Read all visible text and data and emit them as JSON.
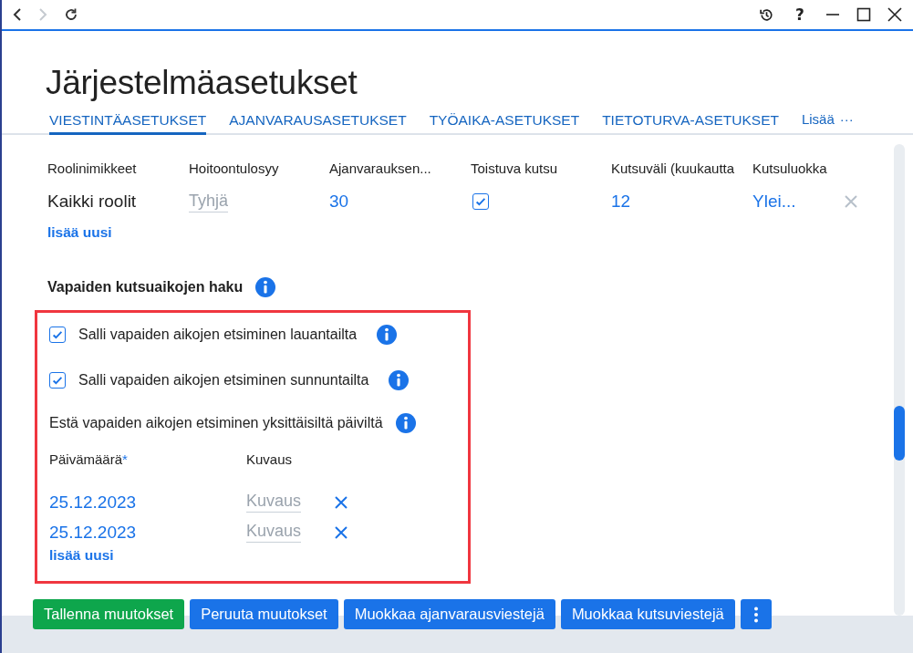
{
  "toolbar": {
    "help": "?"
  },
  "page_title": "Järjestelmäasetukset",
  "tabs": [
    {
      "label": "VIESTINTÄASETUKSET",
      "selected": true
    },
    {
      "label": "AJANVARAUSASETUKSET",
      "selected": false
    },
    {
      "label": "TYÖAIKA-ASETUKSET",
      "selected": false
    },
    {
      "label": "TIETOTURVA-ASETUKSET",
      "selected": false
    }
  ],
  "more_tab": {
    "label": "Lisää",
    "dots": "···"
  },
  "roles_table": {
    "columns": [
      "Roolinimikkeet",
      "Hoitoontulosyy",
      "Ajanvarauksen...",
      "Toistuva kutsu",
      "Kutsuväli (kuukautta",
      "Kutsuluokka"
    ],
    "rows": [
      {
        "role": "Kaikki roolit",
        "reason_placeholder": "Tyhjä",
        "booking": "30",
        "recurring_checked": true,
        "interval": "12",
        "class": "Ylei..."
      }
    ],
    "add_link": "lisää uusi"
  },
  "free_slots": {
    "heading": "Vapaiden kutsuaikojen haku",
    "options": [
      {
        "label": "Salli vapaiden aikojen etsiminen lauantailta",
        "checked": true
      },
      {
        "label": "Salli vapaiden aikojen etsiminen sunnuntailta",
        "checked": true
      }
    ],
    "block_heading": "Estä vapaiden aikojen etsiminen yksittäisiltä päiviltä",
    "columns": [
      {
        "label": "Päivämäärä",
        "required": true
      },
      {
        "label": "Kuvaus",
        "required": false
      }
    ],
    "required_mark": "*",
    "rows": [
      {
        "date": "25.12.2023",
        "description_placeholder": "Kuvaus"
      },
      {
        "date": "25.12.2023",
        "description_placeholder": "Kuvaus"
      }
    ],
    "add_link": "lisää uusi"
  },
  "buttons": [
    {
      "label": "Tallenna muutokset",
      "kind": "primary"
    },
    {
      "label": "Peruuta muutokset",
      "kind": "secondary"
    },
    {
      "label": "Muokkaa ajanvarausviestejä",
      "kind": "secondary"
    },
    {
      "label": "Muokkaa kutsuviestejä",
      "kind": "secondary"
    }
  ]
}
